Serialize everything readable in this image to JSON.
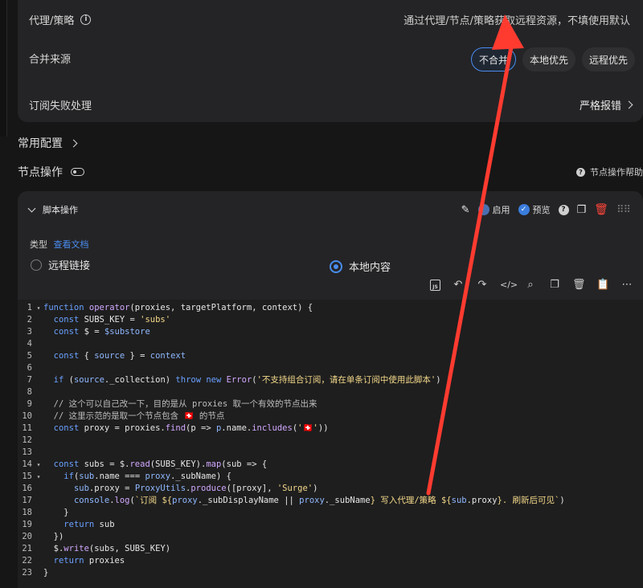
{
  "settings": {
    "proxy_label": "代理/策略",
    "proxy_hint": "通过代理/节点/策略获取远程资源，不填使用默认",
    "merge_label": "合并来源",
    "merge_options": [
      "不合并",
      "本地优先",
      "远程优先"
    ],
    "fail_label": "订阅失败处理",
    "fail_value": "严格报错"
  },
  "sections": {
    "common": "常用配置",
    "node_ops": "节点操作",
    "node_help": "节点操作帮助"
  },
  "script": {
    "title": "脚本操作",
    "enable_label": "启用",
    "preview_label": "预览",
    "type_label": "类型",
    "docs_link": "查看文档",
    "remote_label": "远程链接",
    "local_label": "本地内容"
  },
  "code_lines": [
    {
      "n": "1",
      "f": "▾",
      "html": "<span class=\"kw\">function</span> <span class=\"fn\">operator</span>(proxies, targetPlatform, context) {"
    },
    {
      "n": "2",
      "f": "",
      "html": "  <span class=\"kw\">const</span> SUBS_KEY = <span class=\"str\">'subs'</span>"
    },
    {
      "n": "3",
      "f": "",
      "html": "  <span class=\"kw\">const</span> $ = <span class=\"var\">$substore</span>"
    },
    {
      "n": "4",
      "f": "",
      "html": ""
    },
    {
      "n": "5",
      "f": "",
      "html": "  <span class=\"kw\">const</span> { <span class=\"var\">source</span> } = <span class=\"var\">context</span>"
    },
    {
      "n": "6",
      "f": "",
      "html": ""
    },
    {
      "n": "7",
      "f": "",
      "html": "  <span class=\"kw\">if</span> (<span class=\"var\">source</span>._collection) <span class=\"kw\">throw new</span> <span class=\"fn\">Error</span>(<span class=\"str\">'不支持组合订阅，请在单条订阅中使用此脚本'</span>)"
    },
    {
      "n": "8",
      "f": "",
      "html": ""
    },
    {
      "n": "9",
      "f": "",
      "html": "  <span class=\"cm\">// 这个可以自己改一下，目的是从 proxies 取一个有效的节点出来</span>"
    },
    {
      "n": "10",
      "f": "",
      "html": "  <span class=\"cm\">// 这里示范的是取一个节点包含 <span class=\"flag\">🇨🇭</span> 的节点</span>"
    },
    {
      "n": "11",
      "f": "",
      "html": "  <span class=\"kw\">const</span> proxy = proxies.<span class=\"fn\">find</span>(p => <span class=\"var\">p</span>.name.<span class=\"fn\">includes</span>(<span class=\"str\">'<span class=\"flag\">🇨🇭</span>'</span>))"
    },
    {
      "n": "12",
      "f": "",
      "html": ""
    },
    {
      "n": "13",
      "f": "",
      "html": ""
    },
    {
      "n": "14",
      "f": "▾",
      "html": "  <span class=\"kw\">const</span> subs = $.<span class=\"fn\">read</span>(SUBS_KEY).<span class=\"fn\">map</span>(sub => {"
    },
    {
      "n": "15",
      "f": "▾",
      "html": "    <span class=\"kw\">if</span>(<span class=\"var\">sub</span>.name === <span class=\"var\">proxy</span>._subName) {"
    },
    {
      "n": "16",
      "f": "",
      "html": "      <span class=\"var\">sub</span>.proxy = <span class=\"var\">ProxyUtils</span>.<span class=\"fn\">produce</span>([proxy], <span class=\"str\">'Surge'</span>)"
    },
    {
      "n": "17",
      "f": "",
      "html": "      <span class=\"var\">console</span>.<span class=\"fn\">log</span>(<span class=\"str\">`订阅 ${</span><span class=\"var\">proxy</span>._subDisplayName || <span class=\"var\">proxy</span>._subName<span class=\"str\">} 写入代理/策略 ${</span><span class=\"var\">sub</span>.proxy<span class=\"str\">}. 刷新后可见`</span>)"
    },
    {
      "n": "18",
      "f": "",
      "html": "    }"
    },
    {
      "n": "19",
      "f": "",
      "html": "    <span class=\"kw\">return</span> sub"
    },
    {
      "n": "20",
      "f": "",
      "html": "  })"
    },
    {
      "n": "21",
      "f": "",
      "html": "  $.<span class=\"fn\">write</span>(subs, SUBS_KEY)"
    },
    {
      "n": "22",
      "f": "",
      "html": "  <span class=\"kw\">return</span> proxies"
    },
    {
      "n": "23",
      "f": "",
      "html": "}"
    }
  ],
  "colors": {
    "accent": "#4a8cf0",
    "annotation_arrow": "#ff3b30",
    "delete": "#ff453a"
  }
}
